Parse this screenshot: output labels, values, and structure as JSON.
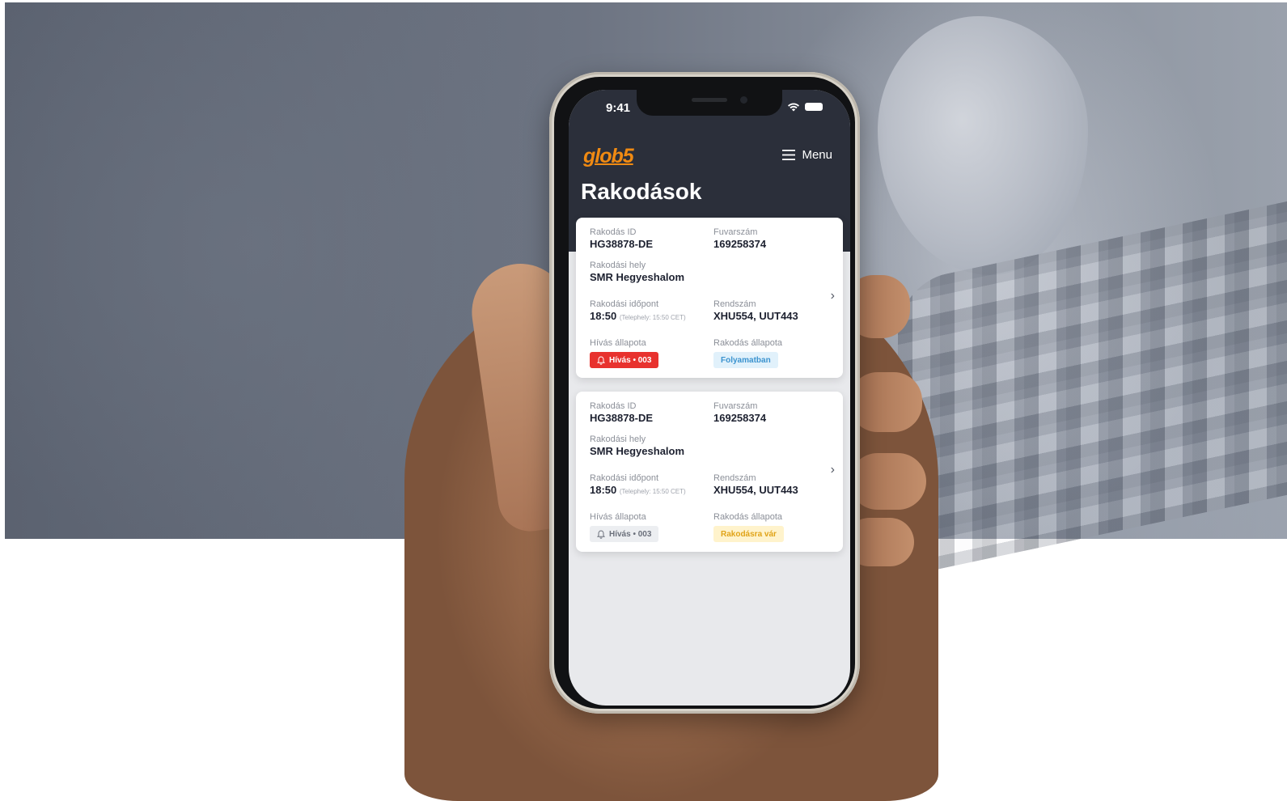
{
  "status_bar": {
    "time": "9:41"
  },
  "app": {
    "logo_text": "glob5",
    "menu_label": "Menu",
    "page_title": "Rakodások"
  },
  "cards": [
    {
      "id_label": "Rakodás ID",
      "id_value": "HG38878-DE",
      "fuvar_label": "Fuvarszám",
      "fuvar_value": "169258374",
      "hely_label": "Rakodási hely",
      "hely_value": "SMR Hegyeshalom",
      "idopont_label": "Rakodási időpont",
      "idopont_value": "18:50",
      "idopont_note": "(Telephely: 15:50 CET)",
      "rendszam_label": "Rendszám",
      "rendszam_value": "XHU554, UUT443",
      "hivas_label": "Hívás állapota",
      "hivas_badge": "Hívás • 003",
      "rakodas_label": "Rakodás állapota",
      "rakodas_badge": "Folyamatban"
    },
    {
      "id_label": "Rakodás ID",
      "id_value": "HG38878-DE",
      "fuvar_label": "Fuvarszám",
      "fuvar_value": "169258374",
      "hely_label": "Rakodási hely",
      "hely_value": "SMR Hegyeshalom",
      "idopont_label": "Rakodási időpont",
      "idopont_value": "18:50",
      "idopont_note": "(Telephely: 15:50 CET)",
      "rendszam_label": "Rendszám",
      "rendszam_value": "XHU554, UUT443",
      "hivas_label": "Hívás állapota",
      "hivas_badge": "Hívás • 003",
      "rakodas_label": "Rakodás állapota",
      "rakodas_badge": "Rakodásra vár"
    }
  ],
  "colors": {
    "header_bg": "#2b2f3a",
    "logo": "#f08a12",
    "badge_call_active": "#e8322e",
    "badge_in_progress": "#3b93cf",
    "badge_waiting": "#e0a318"
  },
  "icons": [
    "wifi-icon",
    "battery-icon",
    "hamburger-menu-icon",
    "bell-icon",
    "chevron-right-icon"
  ]
}
